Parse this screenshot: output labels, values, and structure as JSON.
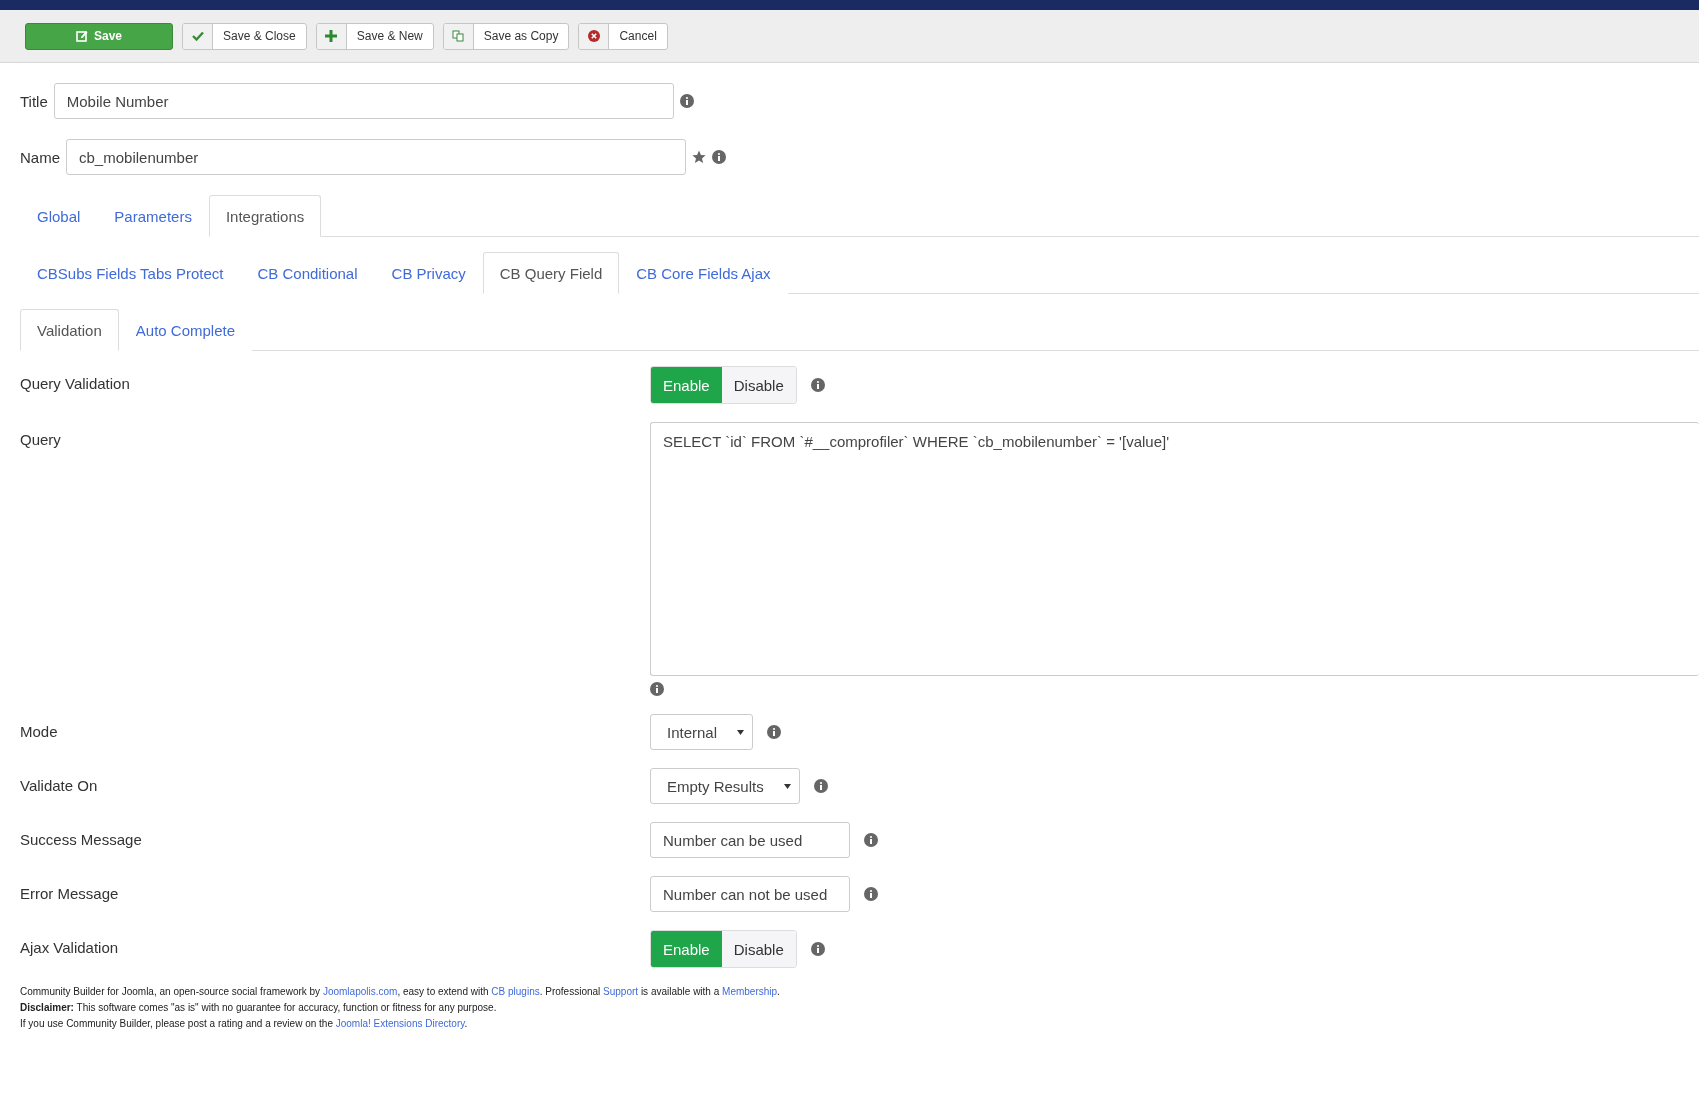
{
  "toolbar": {
    "buttons": [
      {
        "label": "Save",
        "kind": "primary"
      },
      {
        "label": "Save & Close",
        "kind": "split"
      },
      {
        "label": "Save & New",
        "kind": "split"
      },
      {
        "label": "Save as Copy",
        "kind": "split"
      },
      {
        "label": "Cancel",
        "kind": "split"
      }
    ]
  },
  "header_fields": [
    {
      "label": "Title",
      "value": "Mobile Number",
      "starred": false
    },
    {
      "label": "Name",
      "value": "cb_mobilenumber",
      "starred": true
    }
  ],
  "tab_rows": [
    [
      {
        "label": "Global",
        "selected": false
      },
      {
        "label": "Parameters",
        "selected": false
      },
      {
        "label": "Integrations",
        "selected": true
      }
    ],
    [
      {
        "label": "CBSubs Fields Tabs Protect",
        "selected": false
      },
      {
        "label": "CB Conditional",
        "selected": false
      },
      {
        "label": "CB Privacy",
        "selected": false
      },
      {
        "label": "CB Query Field",
        "selected": true
      },
      {
        "label": "CB Core Fields Ajax",
        "selected": false
      }
    ],
    [
      {
        "label": "Validation",
        "selected": true
      },
      {
        "label": "Auto Complete",
        "selected": false
      }
    ]
  ],
  "form_rows": [
    {
      "kind": "toggle",
      "label": "Query Validation",
      "options": [
        {
          "label": "Enable",
          "selected": true
        },
        {
          "label": "Disable",
          "selected": false
        }
      ]
    },
    {
      "kind": "textarea",
      "label": "Query",
      "value": "SELECT `id` FROM `#__comprofiler` WHERE `cb_mobilenumber` = '[value]'"
    },
    {
      "kind": "select",
      "label": "Mode",
      "value": "Internal"
    },
    {
      "kind": "select",
      "label": "Validate On",
      "value": "Empty Results"
    },
    {
      "kind": "text",
      "label": "Success Message",
      "value": "Number can be used"
    },
    {
      "kind": "text",
      "label": "Error Message",
      "value": "Number can not be used"
    },
    {
      "kind": "toggle",
      "label": "Ajax Validation",
      "options": [
        {
          "label": "Enable",
          "selected": true
        },
        {
          "label": "Disable",
          "selected": false
        }
      ]
    }
  ],
  "footer": [
    [
      {
        "text": "Community Builder for Joomla, an open-source social framework by ",
        "link": false
      },
      {
        "text": "Joomlapolis.com",
        "link": true
      },
      {
        "text": ", easy to extend with ",
        "link": false
      },
      {
        "text": "CB plugins",
        "link": true
      },
      {
        "text": ". Professional ",
        "link": false
      },
      {
        "text": "Support",
        "link": true
      },
      {
        "text": " is available with a ",
        "link": false
      },
      {
        "text": "Membership",
        "link": true
      },
      {
        "text": ".",
        "link": false
      }
    ],
    [
      {
        "text": "**Disclaimer:** This software comes \"as is\" with no guarantee for accuracy, function or fitness for any purpose.",
        "link": false
      }
    ],
    [
      {
        "text": "If you use Community Builder, please post a rating and a review on the ",
        "link": false
      },
      {
        "text": "Joomla! Extensions Directory",
        "link": true
      },
      {
        "text": ".",
        "link": false
      }
    ]
  ]
}
